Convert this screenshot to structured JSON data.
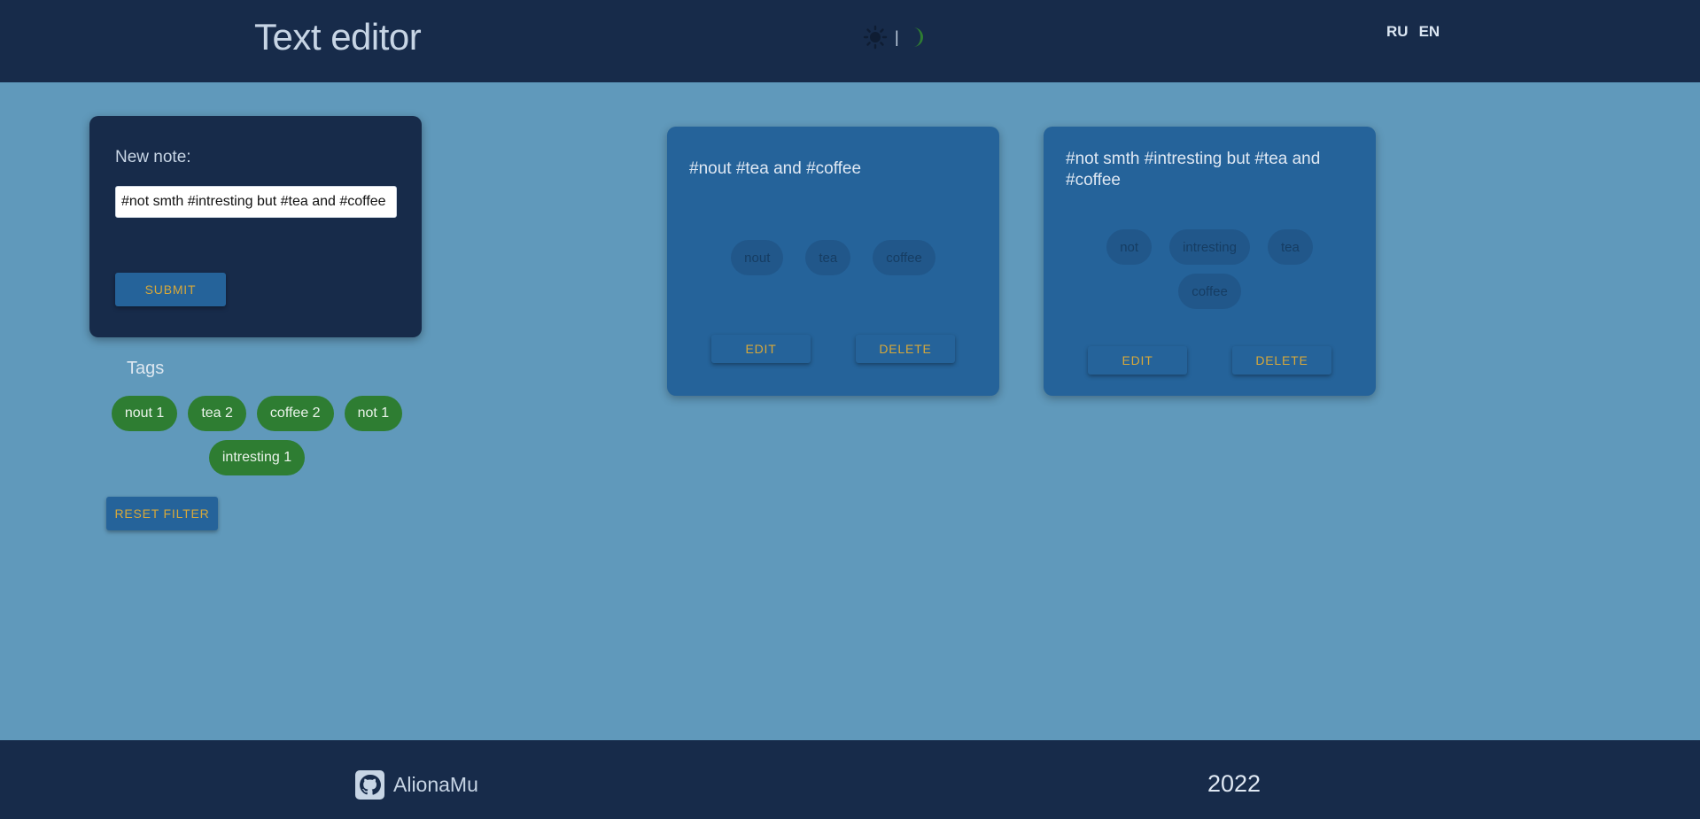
{
  "header": {
    "title": "Text editor",
    "theme_divider": "|",
    "icons": {
      "light": "sun-icon",
      "dark": "moon-icon"
    },
    "languages": [
      "RU",
      "EN"
    ]
  },
  "form": {
    "label": "New note:",
    "input_value": "#not smth #intresting but #tea and #coffee",
    "submit_label": "SUBMIT"
  },
  "tags_panel": {
    "title": "Tags",
    "tags": [
      {
        "label": "nout 1"
      },
      {
        "label": "tea 2"
      },
      {
        "label": "coffee 2"
      },
      {
        "label": "not 1"
      },
      {
        "label": "intresting 1"
      }
    ],
    "reset_label": "RESET FILTER"
  },
  "notes": [
    {
      "text": "#nout #tea and #coffee",
      "tags": [
        "nout",
        "tea",
        "coffee"
      ],
      "edit_label": "EDIT",
      "delete_label": "DELETE"
    },
    {
      "text": "#not smth #intresting but #tea and #coffee",
      "tags": [
        "not",
        "intresting",
        "tea",
        "coffee"
      ],
      "edit_label": "EDIT",
      "delete_label": "DELETE"
    }
  ],
  "footer": {
    "author": "AlionaMu",
    "year": "2022",
    "icon": "github-icon"
  },
  "colors": {
    "background": "#6099bb",
    "header_footer": "#172b4a",
    "card": "#25639a",
    "tag_chip": "#2e7d32",
    "button_text": "#d7a83a"
  }
}
